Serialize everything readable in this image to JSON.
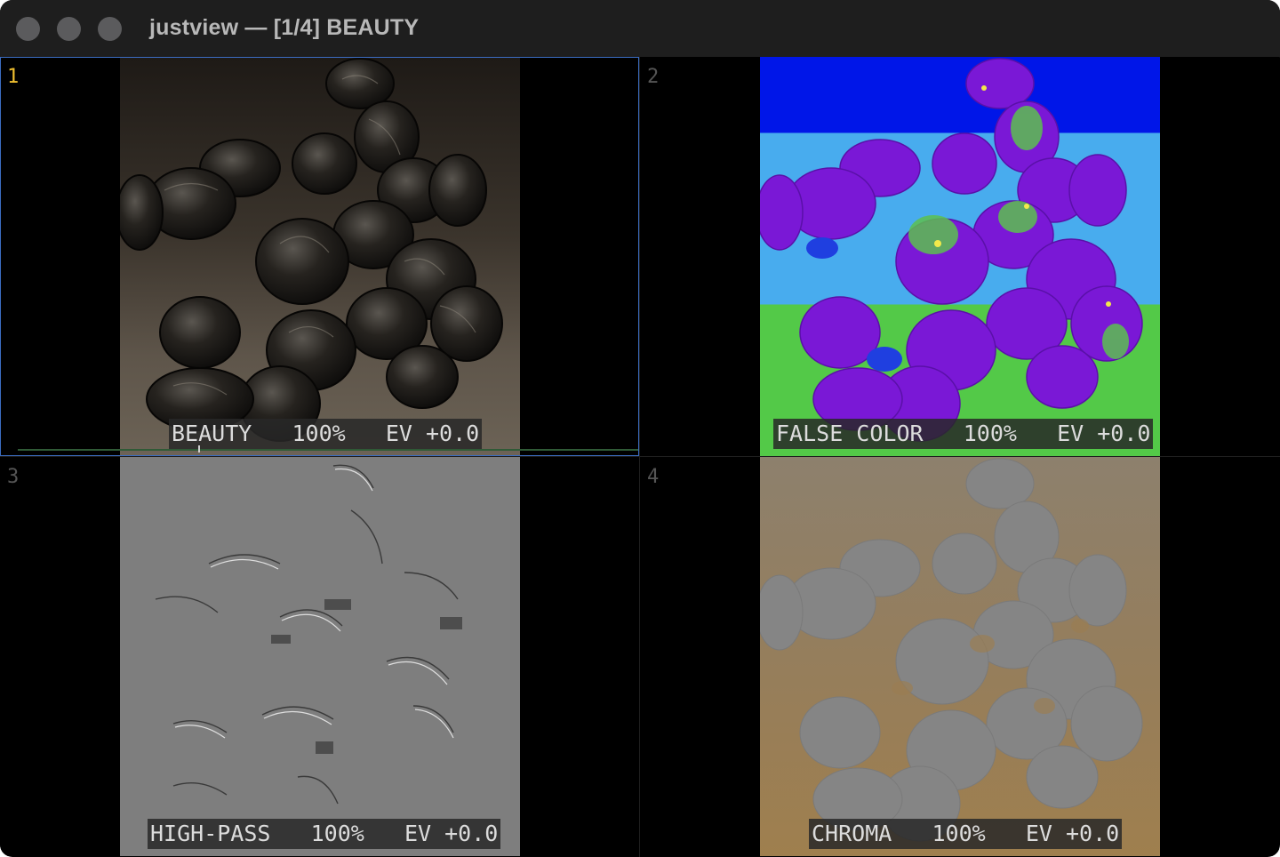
{
  "window": {
    "title": "justview — [1/4] BEAUTY"
  },
  "panes": [
    {
      "index": "1",
      "mode": "BEAUTY",
      "zoom": "100%",
      "ev": "EV +0.0",
      "active": true
    },
    {
      "index": "2",
      "mode": "FALSE COLOR",
      "zoom": "100%",
      "ev": "EV +0.0",
      "active": false
    },
    {
      "index": "3",
      "mode": "HIGH-PASS",
      "zoom": "100%",
      "ev": "EV +0.0",
      "active": false
    },
    {
      "index": "4",
      "mode": "CHROMA",
      "zoom": "100%",
      "ev": "EV +0.0",
      "active": false
    }
  ],
  "hud": {
    "p1": "BEAUTY   100%   EV +0.0",
    "p2": "FALSE COLOR   100%   EV +0.0",
    "p3": "HIGH-PASS   100%   EV +0.0",
    "p4": "CHROMA   100%   EV +0.0"
  },
  "colors": {
    "active_border": "#3b6cc0",
    "active_index": "#f0c030",
    "false_color_bands": [
      "#0016e8",
      "#48acee",
      "#53c948"
    ],
    "chroma_bg": "#9f7f4e",
    "highpass_bg": "#7e7e7e"
  },
  "icons": [
    "window-close-icon",
    "window-minimize-icon",
    "window-zoom-icon"
  ]
}
